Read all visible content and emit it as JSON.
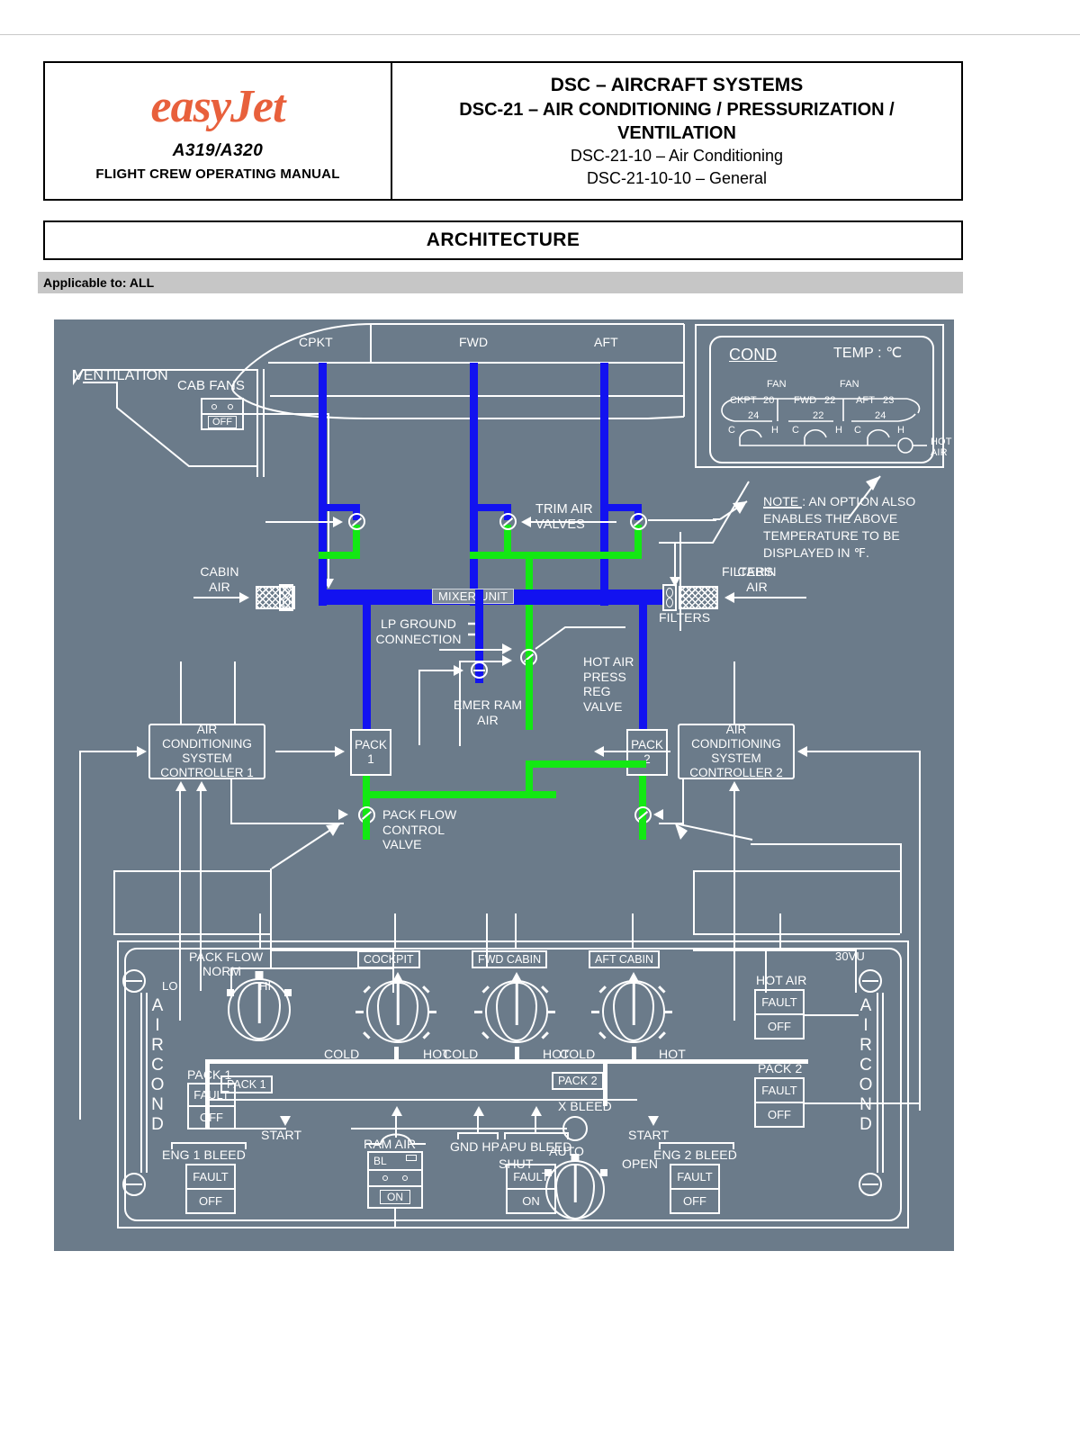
{
  "header": {
    "logo_text": "easyJet",
    "model": "A319/A320",
    "manual": "FLIGHT CREW OPERATING MANUAL",
    "line1": "DSC – AIRCRAFT SYSTEMS",
    "line2": "DSC-21 – AIR CONDITIONING / PRESSURIZATION / VENTILATION",
    "line3": "DSC-21-10 – Air Conditioning",
    "line4": "DSC-21-10-10 – General",
    "section_title": "ARCHITECTURE",
    "applicable": "Applicable to: ALL"
  },
  "diagram": {
    "aircraft_zones": [
      "CPKT",
      "FWD",
      "AFT"
    ],
    "ventilation_label": "VENTILATION",
    "cab_fans_label": "CAB FANS",
    "cab_fans_button": "OFF",
    "cabin_air_left": "CABIN\nAIR",
    "cabin_air_right": "CABIN\nAIR",
    "filters_label": "FILTERS",
    "mixer_unit": "MIXER UNIT",
    "trim_air_valves": "TRIM AIR\nVALVES",
    "lp_ground_connection": "LP GROUND\nCONNECTION",
    "emer_ram_air": "EMER RAM\nAIR",
    "hot_air_press_reg_valve": "HOT AIR\nPRESS\nREG\nVALVE",
    "pack_flow_control_valve": "PACK FLOW\nCONTROL\nVALVE",
    "controller_1": "AIR\nCONDITIONING\nSYSTEM\nCONTROLLER 1",
    "controller_2": "AIR\nCONDITIONING\nSYSTEM\nCONTROLLER 2",
    "pack_1": "PACK\n1",
    "pack_2": "PACK\n2",
    "note": "NOTE : AN OPTION ALSO\nENABLES THE ABOVE\nTEMPERATURE TO BE\nDISPLAYED IN ℉.",
    "ecam": {
      "title": "COND",
      "temp_units": "TEMP : ℃",
      "fan_left": "FAN",
      "fan_right": "FAN",
      "zones": [
        {
          "name": "CKPT",
          "actual": "20",
          "selected": "24",
          "cold": "C",
          "hot": "H"
        },
        {
          "name": "FWD",
          "actual": "22",
          "selected": "22",
          "cold": "C",
          "hot": "H"
        },
        {
          "name": "AFT",
          "actual": "23",
          "selected": "24",
          "cold": "C",
          "hot": "H"
        }
      ],
      "hot_air_label": "HOT\nAIR"
    }
  },
  "panel": {
    "panel_code": "30VU",
    "left_vertical_label": "AIRCOND",
    "right_vertical_label": "AIRCOND",
    "pack_flow": {
      "title": "PACK FLOW",
      "norm": "NORM",
      "lo": "LO",
      "hi": "HI"
    },
    "temp_selectors": [
      {
        "title": "COCKPIT",
        "cold": "COLD",
        "hot": "HOT"
      },
      {
        "title": "FWD CABIN",
        "cold": "COLD",
        "hot": "HOT"
      },
      {
        "title": "AFT CABIN",
        "cold": "COLD",
        "hot": "HOT"
      }
    ],
    "x_bleed": {
      "title": "X BLEED",
      "shut": "SHUT",
      "auto": "AUTO",
      "open": "OPEN"
    },
    "ram_air": {
      "title": "RAM AIR",
      "bl": "BL",
      "on": "ON"
    },
    "pushbuttons": [
      {
        "caption": "PACK 1",
        "top": "FAULT",
        "bottom": "OFF"
      },
      {
        "caption": "ENG 1 BLEED",
        "top": "FAULT",
        "bottom": "OFF"
      },
      {
        "caption": "APU BLEED",
        "top": "FAULT",
        "bottom": "ON"
      },
      {
        "caption": "ENG 2 BLEED",
        "top": "FAULT",
        "bottom": "OFF"
      },
      {
        "caption": "HOT AIR",
        "top": "FAULT",
        "bottom": "OFF"
      },
      {
        "caption": "PACK 2",
        "top": "FAULT",
        "bottom": "OFF"
      }
    ],
    "tags": {
      "pack1": "PACK 1",
      "pack2": "PACK 2",
      "start_left": "START",
      "start_right": "START",
      "gnd_hp": "GND HP",
      "apu_bleed": "APU BLEED"
    }
  },
  "colors": {
    "background": "#6b7b8a",
    "duct_cold": "#1212f0",
    "duct_hot": "#13e813",
    "line": "#ffffff",
    "brand": "#E8603C",
    "band": "#c6c6c6"
  }
}
